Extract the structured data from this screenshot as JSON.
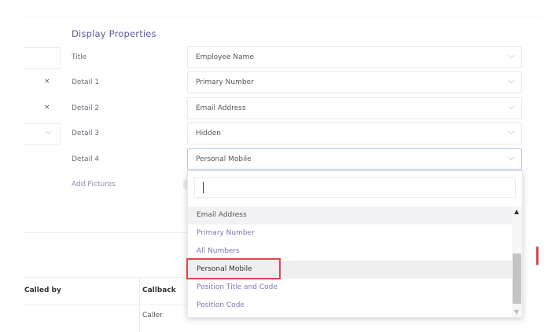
{
  "section": {
    "title": "Display Properties"
  },
  "rows": [
    {
      "label": "Title",
      "value": "Employee Name",
      "left": ""
    },
    {
      "label": "Detail 1",
      "value": "Primary Number",
      "left": "×"
    },
    {
      "label": "Detail 2",
      "value": "Email Address",
      "left": "×"
    },
    {
      "label": "Detail 3",
      "value": "Hidden",
      "left": "⌵"
    },
    {
      "label": "Detail 4",
      "value": "Personal Mobile",
      "left": ""
    }
  ],
  "chevron": "⌵",
  "add_pictures": "Add Pictures",
  "dropdown": {
    "search_value": "",
    "options": [
      "Email Address",
      "Primary Number",
      "All Numbers",
      "Personal Mobile",
      "Position Title and Code",
      "Position Code"
    ],
    "selected": "Personal Mobile"
  },
  "table": {
    "headers": [
      "Called by",
      "Callback"
    ],
    "cell": "Caller"
  },
  "colors": {
    "accent": "#5a5aa0",
    "highlight_border": "#e3444c"
  }
}
